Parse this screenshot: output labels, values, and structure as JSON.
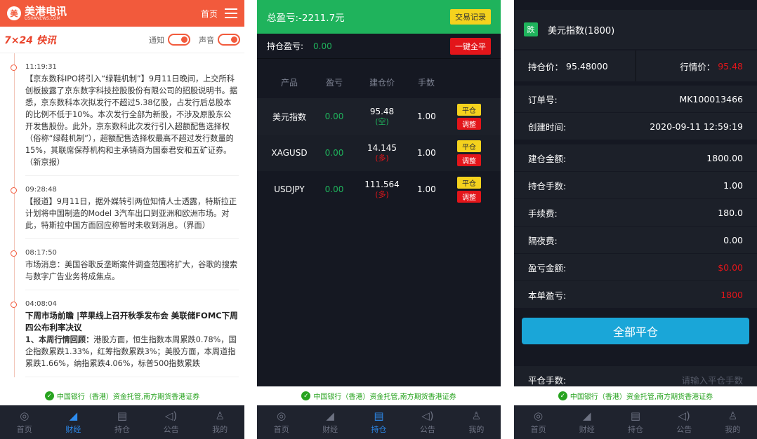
{
  "news_app": {
    "logo_mark": "美",
    "logo_name": "美港电讯",
    "logo_sub": "USHANEWS.COM",
    "home_link": "首页",
    "brand": "7×24 快讯",
    "notify_label": "通知",
    "sound_label": "声音",
    "items": [
      {
        "time": "11:19:31",
        "title": "",
        "text": "【京东数科IPO将引入“绿鞋机制”】9月11日晚间，上交所科创板披露了京东数字科技控股股份有限公司的招股说明书。据悉，京东数科本次拟发行不超过5.38亿股，占发行后总股本的比例不低于10%。本次发行全部为新股，不涉及原股东公开发售股份。此外，京东数科此次发行引入超额配售选择权（俗称“绿鞋机制”），超额配售选择权最高不超过发行数量的15%，其联席保荐机构和主承销商为国泰君安和五矿证券。（新京报）"
      },
      {
        "time": "09:28:48",
        "title": "",
        "text": "【报道】9月11日，据外媒转引两位知情人士透露，特斯拉正计划将中国制造的Model 3汽车出口到亚洲和欧洲市场。对此，特斯拉中国方面回应称暂时未收到消息。（界面）"
      },
      {
        "time": "08:17:50",
        "title": "",
        "text": "市场消息：美国谷歌反垄断案件调查范围将扩大，谷歌的搜索与数字广告业务将成焦点。"
      },
      {
        "time": "04:08:04",
        "title": "下周市场前瞻 |苹果线上召开秋季发布会 美联储FOMC下周四公布利率决议",
        "text_bold": "1、本周行情回顾：",
        "text": "港股方面，恒生指数本周累跌0.78%，国企指数累跌1.33%，红筹指数累跌3%；美股方面，本周道指累跌1.66%，纳指累跌4.06%，标普500指数累跌"
      }
    ]
  },
  "banner": {
    "text": "中国银行（香港）资金托管,南方期货香港证券"
  },
  "nav": {
    "items": [
      {
        "label": "首页",
        "icon": "globe-icon"
      },
      {
        "label": "财经",
        "icon": "finance-icon"
      },
      {
        "label": "持仓",
        "icon": "position-icon"
      },
      {
        "label": "公告",
        "icon": "speaker-icon"
      },
      {
        "label": "我的",
        "icon": "user-icon"
      }
    ]
  },
  "positions": {
    "total_label": "总盈亏:-2211.7元",
    "records_button": "交易记录",
    "hold_label": "持仓盈亏:",
    "hold_value": "0.00",
    "close_all_button": "一键全平",
    "headers": [
      "产品",
      "盈亏",
      "建仓价",
      "手数"
    ],
    "close_btn": "平仓",
    "adjust_btn": "调整",
    "rows": [
      {
        "product": "美元指数",
        "pl": "0.00",
        "price": "95.48",
        "side": "(空)",
        "lots": "1.00"
      },
      {
        "product": "XAGUSD",
        "pl": "0.00",
        "price": "14.145",
        "side": "(多)",
        "lots": "1.00"
      },
      {
        "product": "USDJPY",
        "pl": "0.00",
        "price": "111.564",
        "side": "(多)",
        "lots": "1.00"
      }
    ]
  },
  "order": {
    "tag": "跌",
    "title": "美元指数(1800)",
    "hold_price_label": "持仓价：",
    "hold_price": "95.48000",
    "market_price_label": "行情价：",
    "market_price": "95.48",
    "order_no_label": "订单号:",
    "order_no": "MK100013466",
    "created_label": "创建时间:",
    "created": "2020-09-11 12:59:19",
    "open_amount_label": "建仓金额:",
    "open_amount": "1800.00",
    "lots_label": "持仓手数:",
    "lots": "1.00",
    "fee_label": "手续费:",
    "fee": "180.0",
    "overnight_label": "隔夜费:",
    "overnight": "0.00",
    "pl_amount_label": "盈亏金额:",
    "pl_amount": "$0.00",
    "order_pl_label": "本单盈亏:",
    "order_pl": "1800",
    "close_all_button": "全部平仓",
    "close_lots_label": "平仓手数:",
    "close_lots_placeholder": "请输入平仓手数"
  }
}
